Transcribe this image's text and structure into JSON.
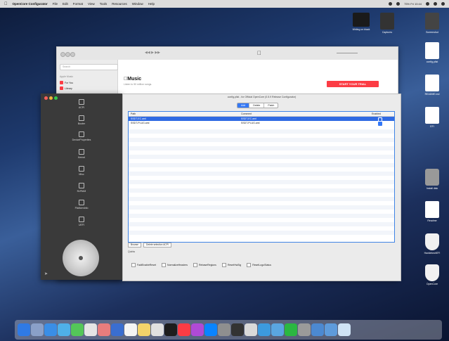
{
  "menubar": {
    "apple": "",
    "app_name": "OpenCore Configurator",
    "items": [
      "File",
      "Edit",
      "Format",
      "View",
      "Tools",
      "Resources",
      "Window",
      "Help"
    ],
    "status_text": "75% Fri 10:44"
  },
  "desktop": {
    "icons": [
      {
        "label": "Writing on black",
        "icon": "terminal-icon"
      },
      {
        "label": "Captures",
        "icon": "document-icon"
      },
      {
        "label": "Screenshot",
        "icon": "document-icon"
      },
      {
        "label": "config.plist",
        "icon": "document-icon"
      },
      {
        "label": "README.md",
        "icon": "document-icon"
      },
      {
        "label": "EFI",
        "icon": "disk-icon"
      },
      {
        "label": "Install disk",
        "icon": "disk-icon"
      },
      {
        "label": "Readme",
        "icon": "document-icon"
      },
      {
        "label": "HackintoshEFI",
        "icon": "shield-icon"
      },
      {
        "label": "OpenCore",
        "icon": "shield-icon"
      }
    ]
  },
  "music": {
    "search_placeholder": "Search",
    "store_label": "Apple Music",
    "side_items": [
      "For You",
      "Library"
    ],
    "logo": "Music",
    "subtitle": "Listen to 50 million songs.",
    "trial_button": "START YOUR TRIAL"
  },
  "clover": {
    "nav": [
      "ACPI",
      "Booter",
      "DeviceProperties",
      "Kernel",
      "Misc",
      "NVRAM",
      "PlatformInfo",
      "UEFI"
    ]
  },
  "configurator": {
    "title": "config.plist - for Official OpenCore (0.5.9 Release Configurator)",
    "tabs": [
      "Add",
      "Delete",
      "Patch"
    ],
    "columns": [
      "Path",
      "Comment",
      "Enabled"
    ],
    "rows": [
      {
        "path": "SSDT-EC.aml",
        "comment": "SSDT-EC.aml",
        "enabled": true
      },
      {
        "path": "SSDT-PLUG.aml",
        "comment": "SSDT-PLUG.aml",
        "enabled": true
      }
    ],
    "buttons": [
      "Browse",
      "Delete selection ACPI"
    ],
    "notes_label": "Quirks",
    "quirks": [
      "FadtEnableReset",
      "NormalizeHeaders",
      "RebaseRegions",
      "ResetHwSig",
      "ResetLogoStatus"
    ]
  },
  "colors": {
    "accent": "#3478f6",
    "music_red": "#fc3c44",
    "selection": "#2f6ae3"
  }
}
